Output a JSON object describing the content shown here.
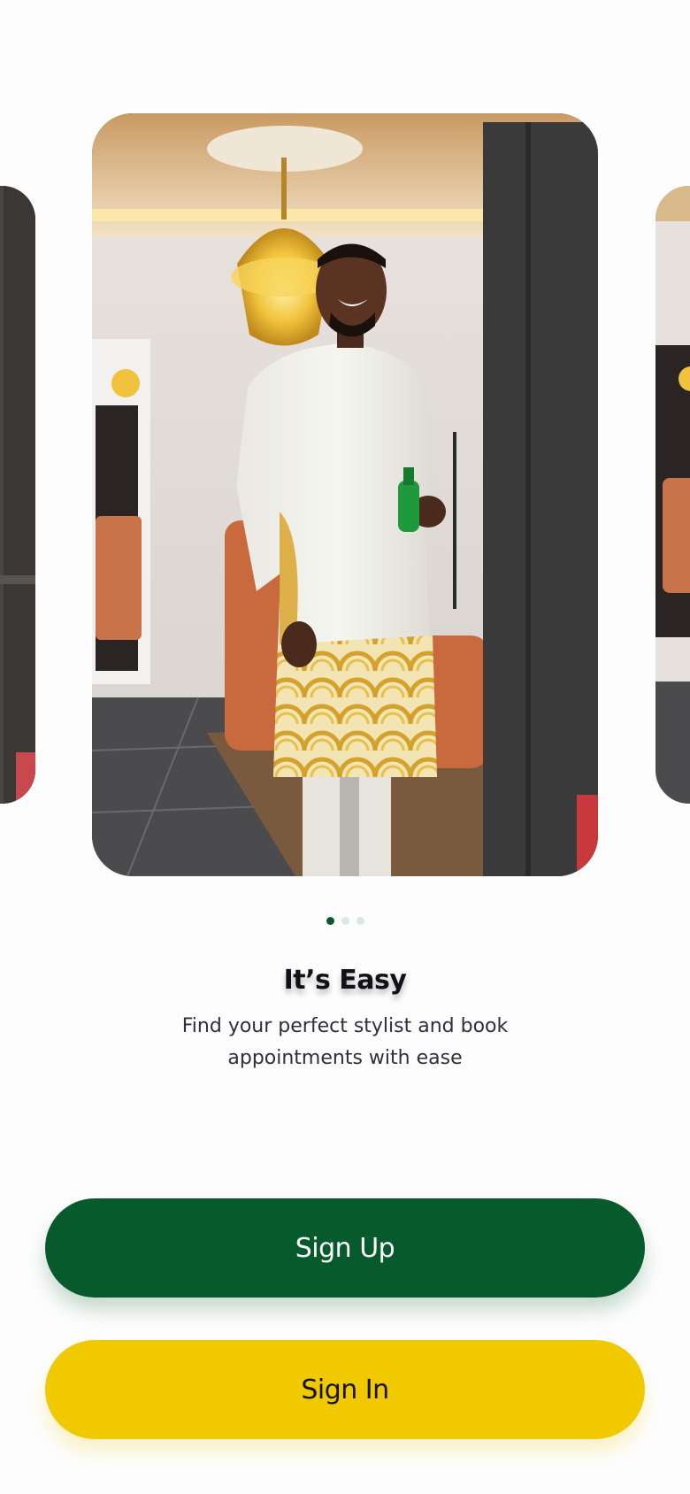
{
  "carousel": {
    "slide_count": 3,
    "active_index": 0
  },
  "onboarding": {
    "title": "It’s Easy",
    "subtitle": "Find your perfect stylist and book appointments with ease"
  },
  "actions": {
    "sign_up_label": "Sign Up",
    "sign_in_label": "Sign In"
  },
  "colors": {
    "primary": "#075a2b",
    "secondary": "#f0c900",
    "dot_inactive": "#d6ebdc"
  }
}
